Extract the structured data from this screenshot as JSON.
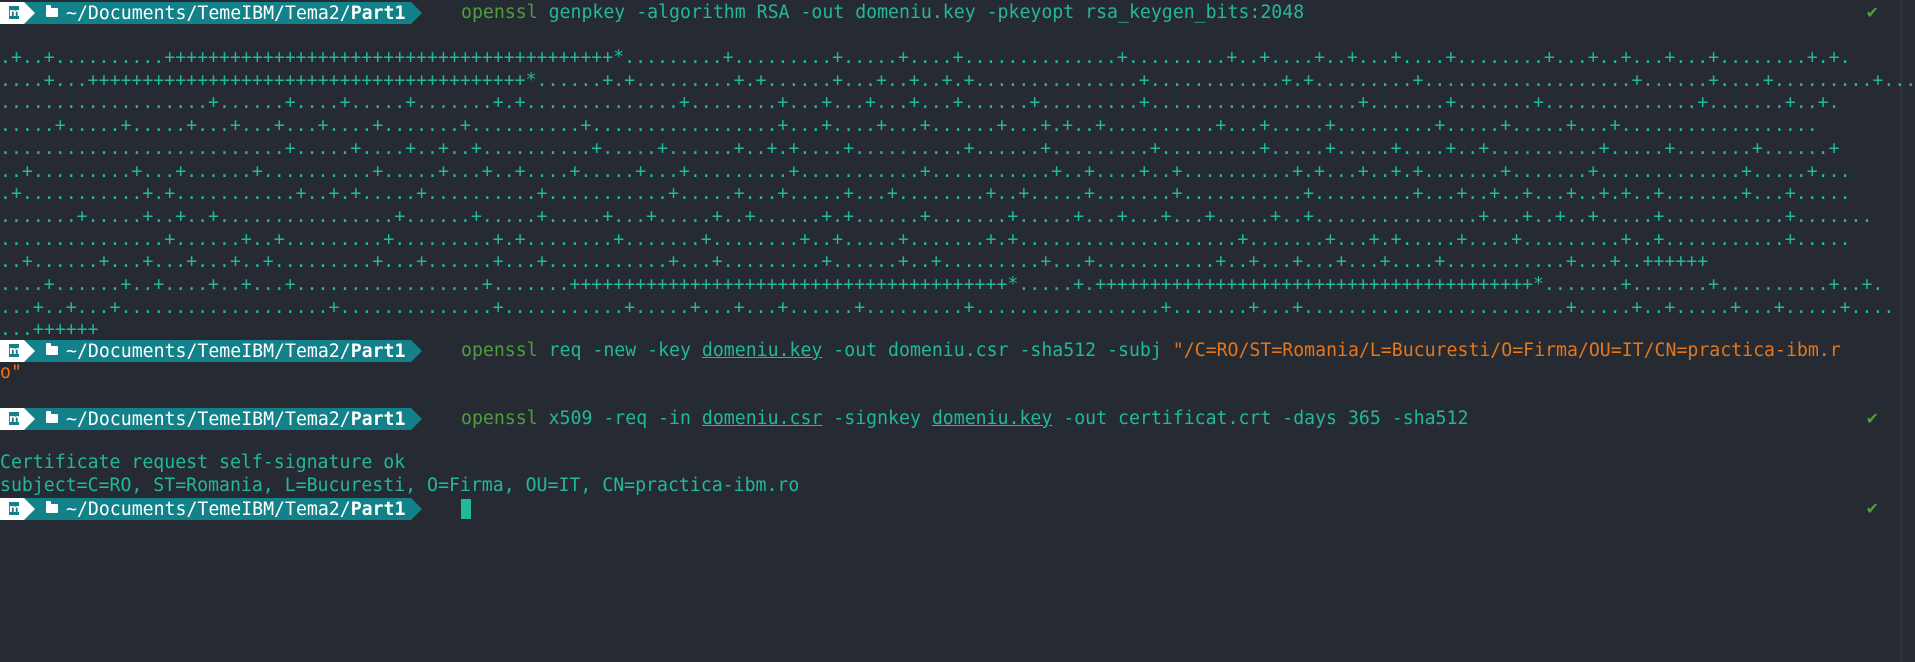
{
  "prompt": {
    "os_icon": "manjaro-icon",
    "folder_icon": "folder-icon",
    "path_prefix": "~/Documents/TemeIBM/Tema2/",
    "path_leaf": "Part1"
  },
  "status_check": "✔",
  "commands": [
    {
      "id": "genpkey",
      "tokens": [
        {
          "t": "openssl",
          "k": "cmd"
        },
        {
          "t": " genpkey -algorithm RSA -out domeniu.key -pkeyopt rsa_keygen_bits:2048",
          "k": "arg"
        }
      ],
      "status": "✔"
    },
    {
      "id": "req",
      "tokens": [
        {
          "t": "openssl",
          "k": "cmd"
        },
        {
          "t": " req -new -key ",
          "k": "arg"
        },
        {
          "t": "domeniu.key",
          "k": "file"
        },
        {
          "t": " -out domeniu.csr -sha512 -subj ",
          "k": "arg"
        },
        {
          "t": "\"/C=RO/ST=Romania/L=Bucuresti/O=Firma/OU=IT/CN=practica-ibm.r",
          "k": "str"
        }
      ],
      "wrap": "o\""
    },
    {
      "id": "x509",
      "tokens": [
        {
          "t": "openssl",
          "k": "cmd"
        },
        {
          "t": " x509 -req -in ",
          "k": "arg"
        },
        {
          "t": "domeniu.csr",
          "k": "file"
        },
        {
          "t": " -signkey ",
          "k": "arg"
        },
        {
          "t": "domeniu.key",
          "k": "file"
        },
        {
          "t": " -out certificat.crt -days 365 -sha512",
          "k": "arg"
        }
      ],
      "status": "✔"
    }
  ],
  "genpkey_output": [
    ".+..+..........+++++++++++++++++++++++++++++++++++++++++*.........+.........+.....+....+..............+.........+..+....+..+...+....+........+...+..+...+...+........+.+.",
    "....+...++++++++++++++++++++++++++++++++++++++++*......+.+.........+.+......+...+..+..+.+...............+............+.+.........+...................+......+....+.........+...+..",
    "...................+......+....+.....+.......+.+..............+........+...+...+...+...+......+.........+...................+.......+.......+..............+.......+..+.",
    ".....+.....+.....+...+...+...+....+.......+..........+.................+...+....+...+......+...+.+..+..........+...+.....+.........+.....+.....+...+..................",
    "..........................+.....+....+..+..+..........+.....+......+..+.+....+..........+......+.........+.........+.....+.....+....+..+..........+.....+.......+......+",
    "..+.........+...+......+..........+.....+...+..+....+.....+...+.........+...........+...........+..+....+..+..........+.+...+..+.+.......+.......+.............+.....+...",
    ".+...........+.+...........+..+.+.....+..........+...........+.....+...+.....+...+........+..+.....+.......+...........+.........+...+..+..+...+..+.+..+.......+...+.....",
    ".......+.....+..+..+................+......+.....+.....+...+.....+..+......+.+......+.......+.....+...+...+...+.....+..+...............+...+..+..+.....+...........+.......",
    "...............+......+..+.........+.........+.+........+.......+........+..+.....+.......+.+....................+.......+...+.+.....+....+.........+..+...........+.....",
    "..+......+...+...+...+..+.........+...+......+...+...........+...+.........+......+..+.........+...+...........+..+...+...+...+....+...........+...+..++++++",
    "....+......+..+....+..+...+.................+.......++++++++++++++++++++++++++++++++++++++++*.....+.++++++++++++++++++++++++++++++++++++++++*.......+.......+..........+..+.",
    "...+..+...+...................+..............+...........+.....+...+...+......+.........+.................+.......+...+........................+.....+..+.....+...+.....+....",
    "...++++++"
  ],
  "x509_output": [
    "Certificate request self-signature ok",
    "subject=C=RO, ST=Romania, L=Bucuresti, O=Firma, OU=IT, CN=practica-ibm.ro"
  ],
  "colors": {
    "background": "#262b33",
    "accent_teal": "#13818a",
    "output_text": "#22b89a",
    "command_green": "#4f9d3f",
    "string_orange": "#e5761b"
  }
}
